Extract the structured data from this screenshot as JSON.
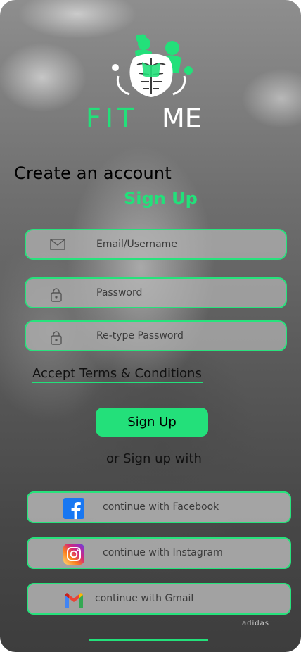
{
  "brand": {
    "logo_icon": "fitness-couple-muscle-logo",
    "name_part1": "FIT",
    "name_part2": "ME",
    "accent": "#23e07a"
  },
  "header": {
    "title": "Create an account",
    "subtitle": "Sign Up"
  },
  "form": {
    "email_placeholder": "Email/Username",
    "password_placeholder": "Password",
    "retype_placeholder": "Re-type Password",
    "email_icon": "envelope-icon",
    "lock_icon": "lock-icon"
  },
  "terms_label": "Accept Terms & Conditions",
  "signup_button": "Sign Up",
  "or_text": "or Sign up with",
  "social": {
    "facebook_label": "continue with Facebook",
    "instagram_label": "continue with Instagram",
    "gmail_label": "continue with Gmail"
  },
  "background_watermark": "adidas"
}
